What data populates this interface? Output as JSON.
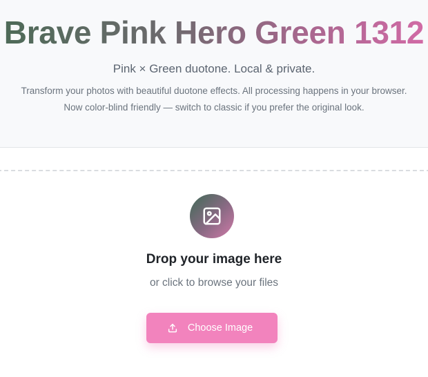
{
  "header": {
    "title": "Brave Pink Hero Green 1312",
    "subtitle": "Pink × Green duotone. Local & private.",
    "description_line_1": "Transform your photos with beautiful duotone effects. All processing happens in your browser.",
    "description_line_2": "Now color-blind friendly — switch to classic if you prefer the original look."
  },
  "dropzone": {
    "icon": "image-icon",
    "title": "Drop your image here",
    "subtitle": "or click to browse your files",
    "button_label": "Choose Image",
    "button_icon": "upload-icon"
  },
  "colors": {
    "green": "#4d6a57",
    "pink": "#d26aa6",
    "button": "#f283bd",
    "header_bg": "#f8f9fb"
  }
}
